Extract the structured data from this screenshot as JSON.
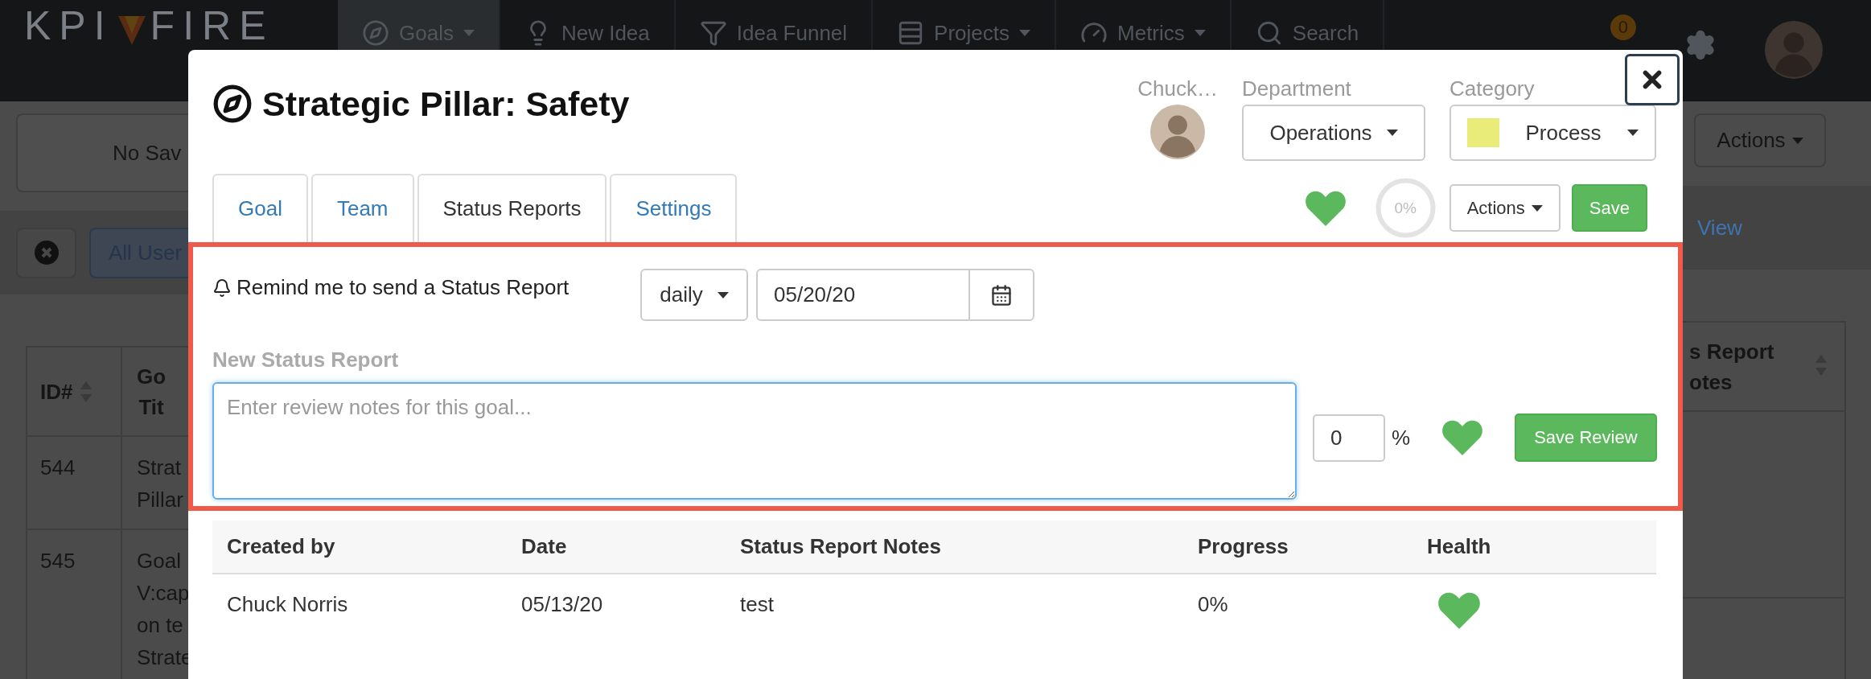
{
  "nav": {
    "logo_left": "KPI",
    "logo_right": "FIRE",
    "notification_count": "0",
    "items": [
      {
        "label": "Goals",
        "caret": true,
        "selected": true
      },
      {
        "label": "New Idea",
        "caret": false,
        "selected": false
      },
      {
        "label": "Idea Funnel",
        "caret": false,
        "selected": false
      },
      {
        "label": "Projects",
        "caret": true,
        "selected": false
      },
      {
        "label": "Metrics",
        "caret": true,
        "selected": false
      },
      {
        "label": "Search",
        "caret": false,
        "selected": false
      }
    ]
  },
  "background": {
    "saved_views_text": "No Sav",
    "actions_button": "Actions",
    "filter_button": "All User",
    "view_link": "View",
    "left_table": {
      "columns": [
        "ID#",
        "Go\nTit"
      ],
      "rows": [
        [
          "544",
          "Strat\nPillar"
        ],
        [
          "545",
          "Goal\nV:cap\non te\nStrate"
        ]
      ]
    },
    "right_table": {
      "columns": [
        "s Report\notes"
      ]
    }
  },
  "modal": {
    "title": "Strategic Pillar: Safety",
    "owner": "Chuck…",
    "department": {
      "label": "Department",
      "value": "Operations"
    },
    "category": {
      "label": "Category",
      "value": "Process",
      "color": "#e9ec79"
    },
    "tabs": [
      {
        "label": "Goal",
        "selected": false
      },
      {
        "label": "Team",
        "selected": false
      },
      {
        "label": "Status Reports",
        "selected": true
      },
      {
        "label": "Settings",
        "selected": false
      }
    ],
    "healthy": true,
    "progress": "0%",
    "actions_button": "Actions",
    "save_button": "Save",
    "status_section": {
      "highlighted": true,
      "reminder_label": "Remind me to send a Status Report",
      "frequency": "daily",
      "date": "05/20/20",
      "new_report_label": "New Status Report",
      "placeholder": "Enter review notes for this goal...",
      "progress_value": "0",
      "percent_sign": "%",
      "healthy": true,
      "save_button": "Save Review"
    },
    "reports_table": {
      "columns": [
        "Created by",
        "Date",
        "Status Report Notes",
        "Progress",
        "Health"
      ],
      "rows": [
        {
          "created_by": "Chuck Norris",
          "date": "05/13/20",
          "notes": "test",
          "progress": "0%",
          "healthy": true
        }
      ]
    }
  }
}
